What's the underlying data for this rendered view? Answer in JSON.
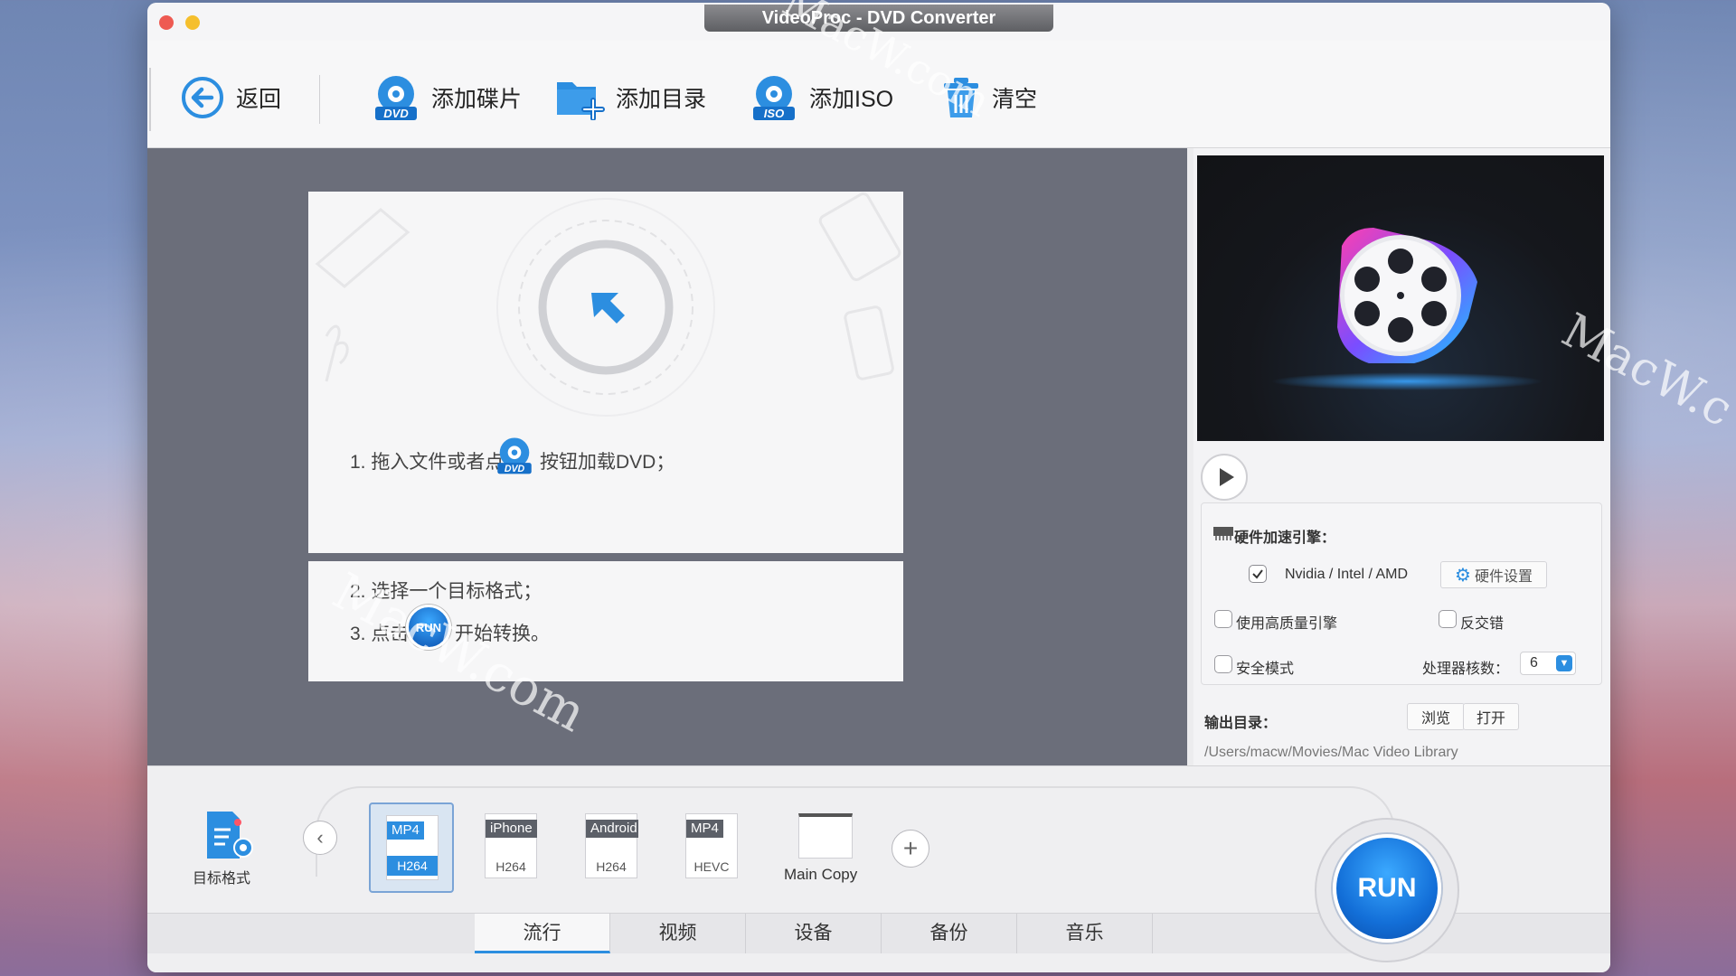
{
  "window": {
    "title": "VideoProc - DVD Converter"
  },
  "toolbar": {
    "back_label": "返回",
    "add_disc_label": "添加碟片",
    "add_folder_label": "添加目录",
    "add_iso_label": "添加ISO",
    "clear_label": "清空",
    "dvd_badge": "DVD",
    "iso_badge": "ISO"
  },
  "instructions": {
    "step1_before": "1. 拖入文件或者点击",
    "step1_after": "按钮加载DVD；",
    "step2": "2. 选择一个目标格式；",
    "step3_before": "3. 点击",
    "step3_after": "开始转换。",
    "run_mini": "RUN"
  },
  "hardware": {
    "title": "硬件加速引擎：",
    "vendor": "Nvidia /  Intel / AMD",
    "settings_button": "硬件设置",
    "high_quality": "使用高质量引擎",
    "deinterlace": "反交错",
    "safe_mode": "安全模式",
    "cores_label": "处理器核数：",
    "cores_value": "6"
  },
  "output": {
    "label": "输出目录：",
    "browse_button": "浏览",
    "open_button": "打开",
    "path": "/Users/macw/Movies/Mac Video Library"
  },
  "bottom": {
    "target_format_label": "目标格式",
    "formats": [
      {
        "top": "MP4",
        "bottom": "H264"
      },
      {
        "top": "iPhone",
        "bottom": "H264"
      },
      {
        "top": "Android",
        "bottom": "H264"
      },
      {
        "top": "MP4",
        "bottom": "HEVC"
      }
    ],
    "main_copy_label": "Main Copy",
    "tabs": [
      "流行",
      "视频",
      "设备",
      "备份",
      "音乐"
    ],
    "run_label": "RUN"
  },
  "watermarks": [
    "MacW.com",
    "MacW.com",
    "MacW.c"
  ],
  "colors": {
    "accent": "#2c8ee0",
    "panel_dark": "#6b6e7a"
  }
}
